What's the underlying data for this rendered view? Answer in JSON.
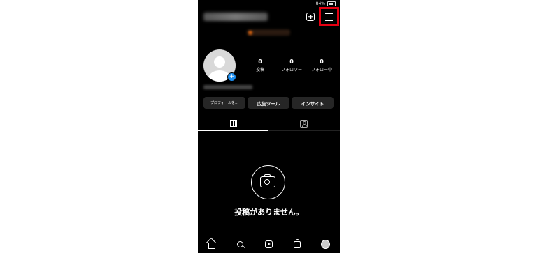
{
  "status_bar": {
    "battery_text": "84%"
  },
  "profile": {
    "stats": [
      {
        "number": "0",
        "label": "投稿"
      },
      {
        "number": "0",
        "label": "フォロワー"
      },
      {
        "number": "0",
        "label": "フォロー中"
      }
    ]
  },
  "actions": {
    "edit_profile": "プロフィールを…",
    "ad_tools": "広告ツール",
    "insights": "インサイト"
  },
  "empty_state": {
    "message": "投稿がありません。"
  },
  "colors": {
    "highlight": "#e60012",
    "accent_blue": "#1c8ef0"
  }
}
